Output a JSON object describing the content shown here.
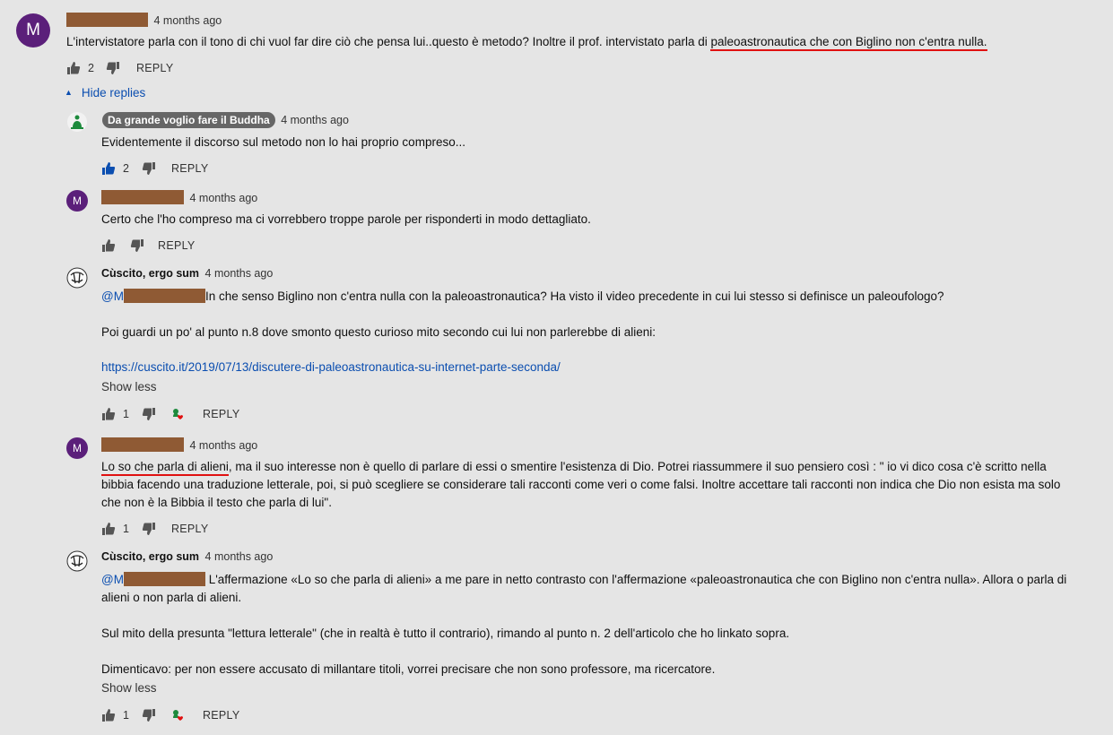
{
  "comments": [
    {
      "avatar_letter": "M",
      "time": "4 months ago",
      "text_before": "L'intervistatore parla con il tono di chi vuol far dire ciò che pensa lui..questo è metodo? Inoltre il prof. intervistato parla di ",
      "text_underlined": "paleoastronautica che con Biglino non c'entra nulla.",
      "likes": "2",
      "reply": "REPLY"
    }
  ],
  "hide_replies": "Hide replies",
  "replies": [
    {
      "author": "Da grande voglio fare il Buddha",
      "time": "4 months ago",
      "text": "Evidentemente il discorso sul metodo non lo hai proprio compreso...",
      "likes": "2",
      "reply": "REPLY"
    },
    {
      "avatar_letter": "M",
      "time": "4 months ago",
      "text": "Certo che l'ho compreso ma ci vorrebbero troppe parole per risponderti in modo dettagliato.",
      "reply": "REPLY"
    },
    {
      "author": "Cùscito, ergo sum",
      "time": "4 months ago",
      "mention": "@M",
      "line1": "In che senso Biglino non c'entra nulla con la paleoastronautica? Ha visto il video precedente in cui lui stesso si definisce un paleoufologo?",
      "line2": "Poi guardi un po' al punto n.8 dove smonto questo curioso mito secondo cui lui non parlerebbe di alieni:",
      "link": "https://cuscito.it/2019/07/13/discutere-di-paleoastronautica-su-internet-parte-seconda/",
      "show_less": "Show less",
      "likes": "1",
      "reply": "REPLY"
    },
    {
      "avatar_letter": "M",
      "time": "4 months ago",
      "text_underlined": "Lo so che parla di alieni",
      "text_rest_1": ", ma il suo interesse non è quello di parlare di essi o smentire l'esistenza di Dio. Potrei riassummere il suo pensiero così : \" io vi dico cosa c'è scritto nella",
      "text_line2": "bibbia facendo una traduzione letterale, poi, si può scegliere se considerare tali racconti come veri o come falsi. Inoltre accettare tali racconti non indica che Dio non esista ma solo",
      "text_line3": "che non è la Bibbia il testo che parla di lui\".",
      "likes": "1",
      "reply": "REPLY"
    },
    {
      "author": "Cùscito, ergo sum",
      "time": "4 months ago",
      "mention": "@M",
      "line1": " L'affermazione «Lo so che parla di alieni» a me pare in netto contrasto con l'affermazione «paleoastronautica che con Biglino non c'entra nulla». Allora o parla di",
      "line1b": "alieni o non parla di alieni.",
      "line2": "Sul mito della presunta \"lettura letterale\" (che in realtà è tutto il contrario), rimando al punto n. 2 dell'articolo che ho linkato sopra.",
      "line3": "Dimenticavo: per non essere accusato di millantare titoli, vorrei precisare che non sono professore, ma ricercatore.",
      "show_less": "Show less",
      "likes": "1",
      "reply": "REPLY"
    }
  ],
  "colors": {
    "background": "#e5e5e5",
    "avatar_purple": "#5b1f7a",
    "link_blue": "#0b4eb0",
    "redaction": "#8f5a34",
    "underline_red": "#e01010",
    "heart": "#e01010"
  }
}
